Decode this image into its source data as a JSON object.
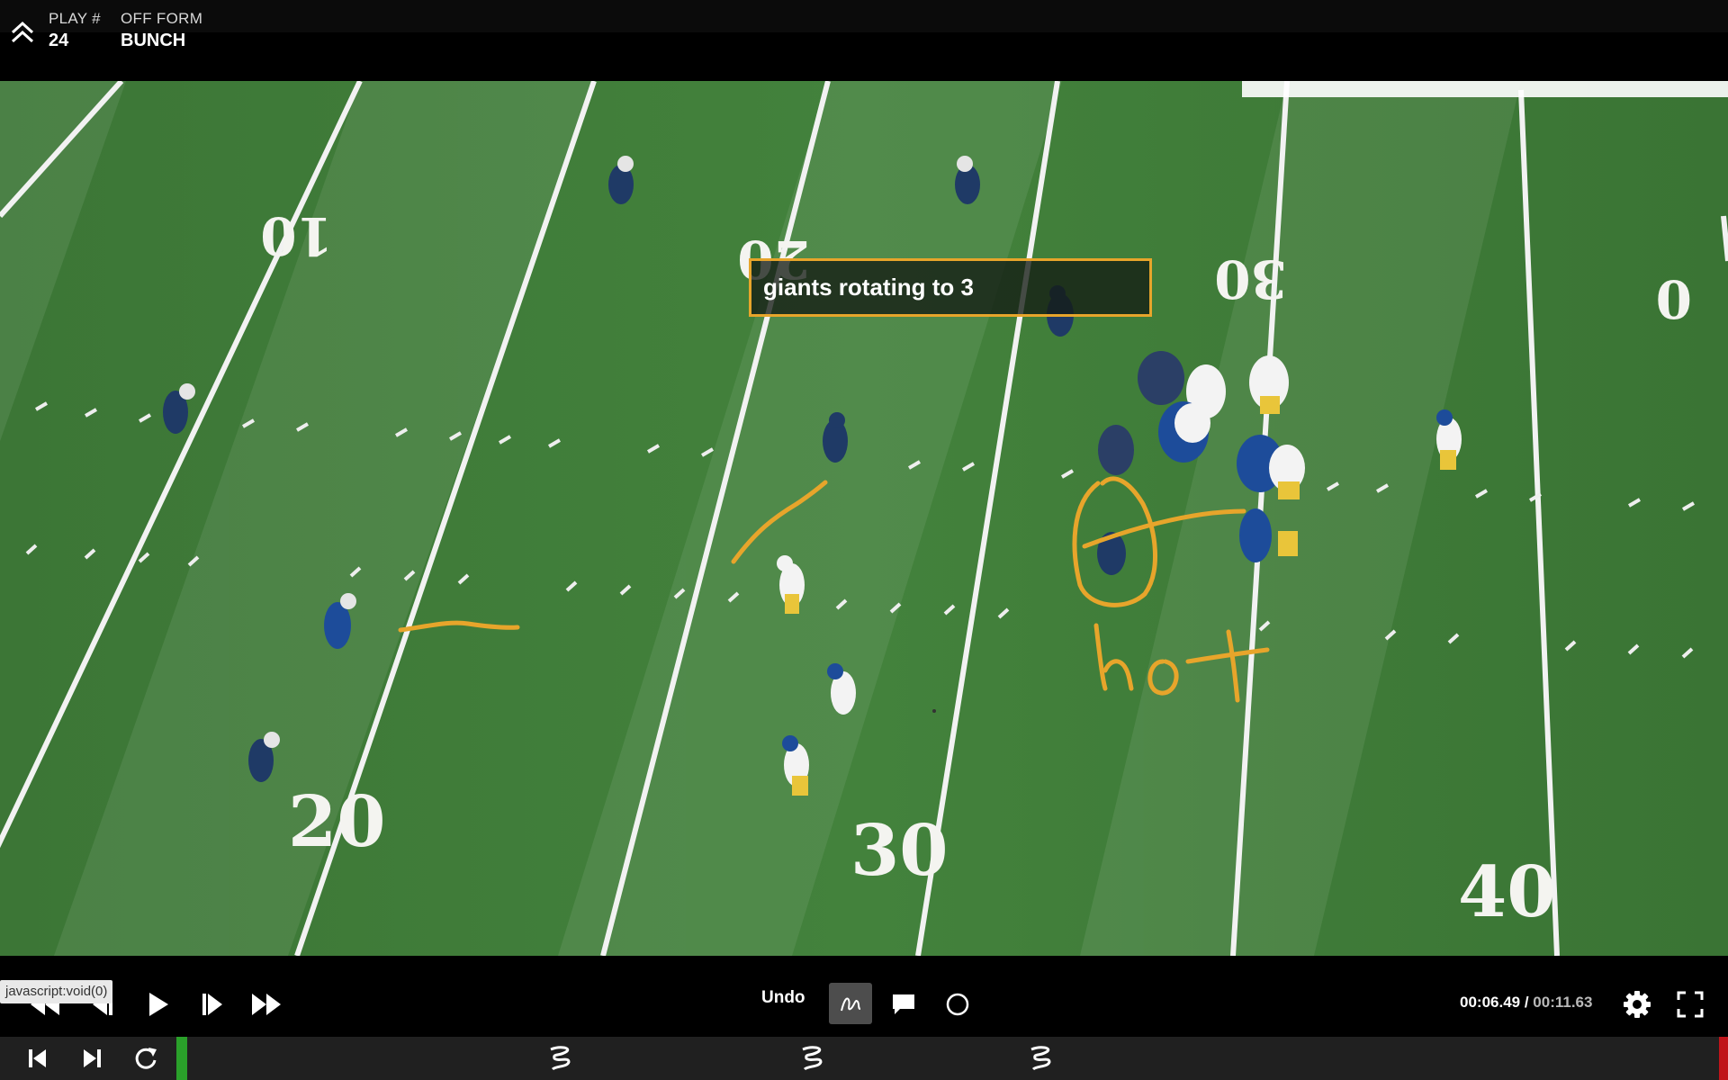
{
  "header": {
    "play_label": "PLAY #",
    "play_value": "24",
    "form_label": "OFF FORM",
    "form_value": "BUNCH"
  },
  "video": {
    "caption": "giants rotating to 3",
    "annotation_text": "hot",
    "yard_numbers_top": [
      "10",
      "20",
      "30",
      "0"
    ],
    "yard_numbers_bottom": [
      "20",
      "30",
      "40"
    ],
    "annotation_color": "#e7a52b"
  },
  "controls": {
    "undo_label": "Undo",
    "time_current": "00:06.49",
    "time_total": "00:11.63",
    "time_separator": " / "
  },
  "status": {
    "tooltip": "javascript:void(0)"
  },
  "colors": {
    "field": "#3f7b3a",
    "playhead": "#2aa02a",
    "end_marker": "#c0141a",
    "bar": "#202020"
  }
}
